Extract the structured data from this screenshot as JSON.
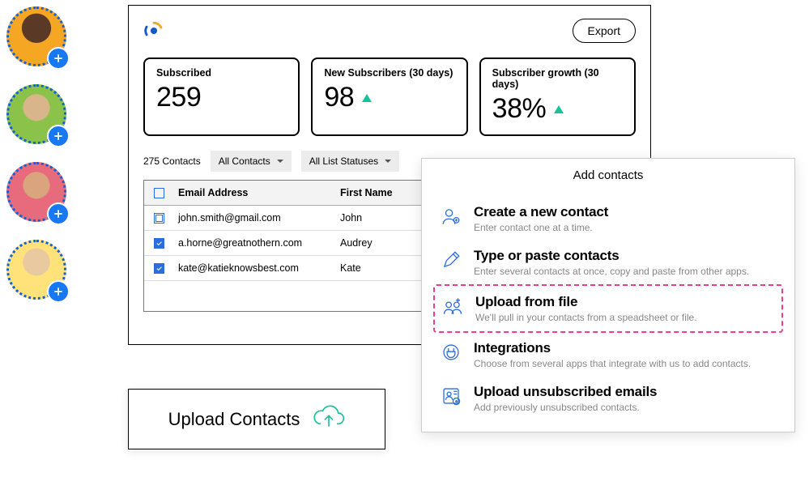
{
  "avatars": [
    {
      "name": "avatar-1"
    },
    {
      "name": "avatar-2"
    },
    {
      "name": "avatar-3"
    },
    {
      "name": "avatar-4"
    }
  ],
  "header": {
    "export_label": "Export"
  },
  "stats": {
    "subscribed": {
      "label": "Subscribed",
      "value": "259"
    },
    "new_subs": {
      "label": "New Subscribers (30 days)",
      "value": "98"
    },
    "growth": {
      "label": "Subscriber growth (30 days)",
      "value": "38%"
    }
  },
  "filters": {
    "contacts_count": "275 Contacts",
    "all_contacts": "All Contacts",
    "all_statuses": "All List Statuses"
  },
  "table": {
    "columns": {
      "email": "Email Address",
      "first": "First Name"
    },
    "rows": [
      {
        "email": "john.smith@gmail.com",
        "first": "John",
        "checked": "partial"
      },
      {
        "email": "a.horne@greatnothern.com",
        "first": "Audrey",
        "checked": "true"
      },
      {
        "email": "kate@katieknowsbest.com",
        "first": "Kate",
        "checked": "true"
      }
    ]
  },
  "add_panel": {
    "title": "Add contacts",
    "items": [
      {
        "title": "Create a new contact",
        "sub": "Enter contact one at a time.",
        "icon": "user-plus-icon"
      },
      {
        "title": "Type or paste contacts",
        "sub": "Enter several contacts at once, copy and paste from other apps.",
        "icon": "pencil-icon"
      },
      {
        "title": "Upload from file",
        "sub": "We'll pull in your contacts from a speadsheet or file.",
        "icon": "people-plus-icon",
        "highlight": true
      },
      {
        "title": "Integrations",
        "sub": "Choose from several apps that integrate with us to add contacts.",
        "icon": "plug-icon"
      },
      {
        "title": "Upload unsubscribed emails",
        "sub": "Add previously unsubscribed contacts.",
        "icon": "contact-card-icon"
      }
    ]
  },
  "upload_card": {
    "title": "Upload Contacts"
  }
}
